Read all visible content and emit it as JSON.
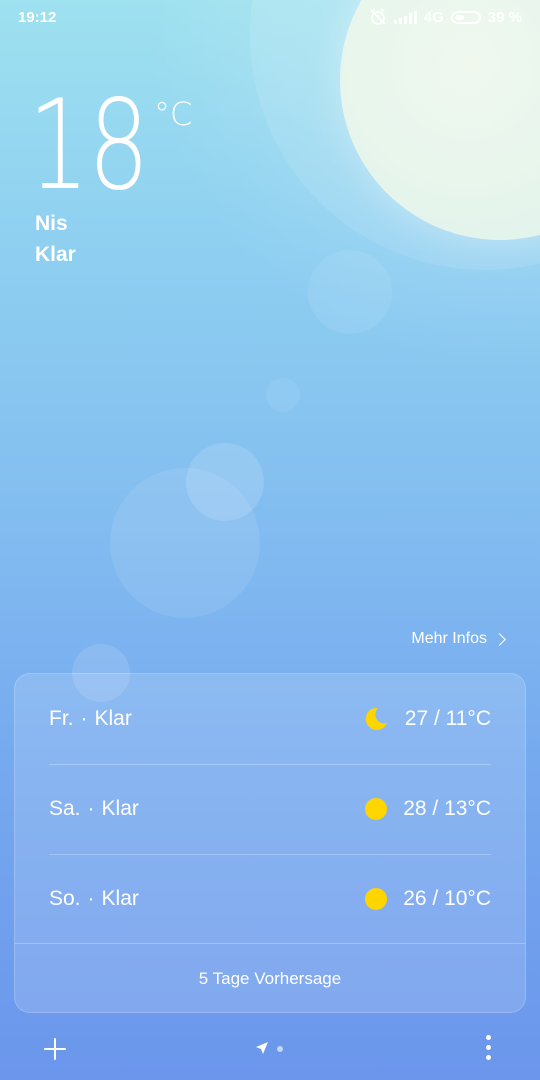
{
  "status_bar": {
    "time": "19:12",
    "network": "4G",
    "battery_percent_text": "39 %",
    "battery_level": 0.39,
    "icons": [
      "alarm-off-icon",
      "signal-icon",
      "battery-icon"
    ]
  },
  "weather": {
    "temperature": "18",
    "unit": "°C",
    "city": "Nis",
    "condition": "Klar"
  },
  "more_infos": {
    "label": "Mehr Infos",
    "icon": "chevron-right-icon"
  },
  "forecast": {
    "days": [
      {
        "day": "Fr.",
        "condition": "Klar",
        "icon": "moon-icon",
        "range": "27 / 11°C"
      },
      {
        "day": "Sa.",
        "condition": "Klar",
        "icon": "sun-icon",
        "range": "28 / 13°C"
      },
      {
        "day": "So.",
        "condition": "Klar",
        "icon": "sun-icon",
        "range": "26 / 10°C"
      }
    ],
    "five_day_label": "5 Tage Vorhersage"
  },
  "bottom_bar": {
    "icons": [
      "add-icon",
      "location-icon",
      "more-icon"
    ]
  },
  "colors": {
    "sun_yellow": "#ffd500",
    "sky_top": "#9ee1ef",
    "sky_bottom": "#6b96ec"
  }
}
